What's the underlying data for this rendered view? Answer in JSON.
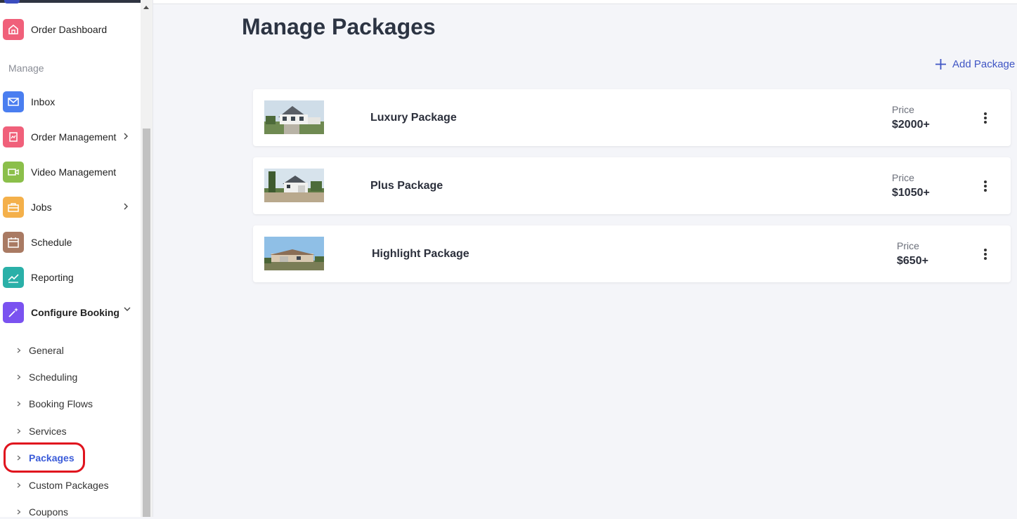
{
  "sidebar": {
    "top_item": {
      "label": "Order Dashboard",
      "icon": "home-icon",
      "color": "#f0607a"
    },
    "section_label": "Manage",
    "items": [
      {
        "label": "Inbox",
        "icon": "mail-icon",
        "color": "#4a7ef0"
      },
      {
        "label": "Order Management",
        "icon": "document-icon",
        "color": "#f0607a",
        "has_chevron": true
      },
      {
        "label": "Video Management",
        "icon": "video-icon",
        "color": "#8bbf4a"
      },
      {
        "label": "Jobs",
        "icon": "briefcase-icon",
        "color": "#f4b04a",
        "has_chevron": true
      },
      {
        "label": "Schedule",
        "icon": "calendar-icon",
        "color": "#a97a63"
      },
      {
        "label": "Reporting",
        "icon": "chart-icon",
        "color": "#2ab0a8"
      },
      {
        "label": "Configure Booking",
        "icon": "magic-wand-icon",
        "color": "#7a52f0",
        "expanded": true
      }
    ],
    "sub_items": [
      {
        "label": "General"
      },
      {
        "label": "Scheduling"
      },
      {
        "label": "Booking Flows"
      },
      {
        "label": "Services"
      },
      {
        "label": "Packages",
        "active": true
      },
      {
        "label": "Custom Packages"
      },
      {
        "label": "Coupons"
      }
    ]
  },
  "main": {
    "title": "Manage Packages",
    "add_button_label": "Add Package",
    "accent_color": "#3f55c4",
    "packages": [
      {
        "name": "Luxury Package",
        "price_label": "Price",
        "price": "$2000+"
      },
      {
        "name": "Plus Package",
        "price_label": "Price",
        "price": "$1050+"
      },
      {
        "name": "Highlight Package",
        "price_label": "Price",
        "price": "$650+"
      }
    ]
  }
}
